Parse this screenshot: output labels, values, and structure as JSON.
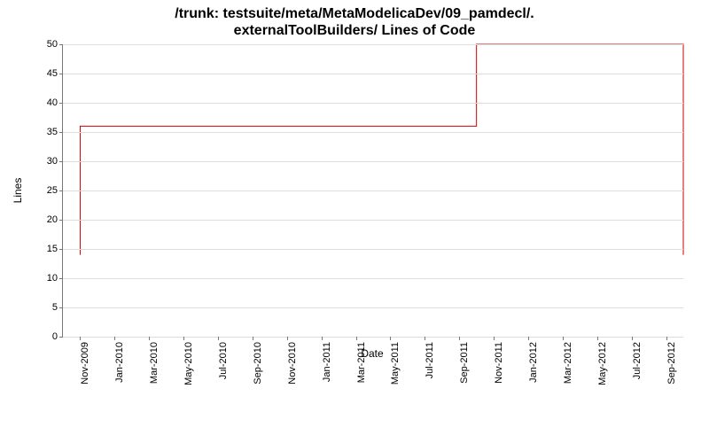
{
  "chart_data": {
    "type": "line",
    "title_line1": "/trunk: testsuite/meta/MetaModelicaDev/09_pamdecl/.",
    "title_line2": "externalToolBuilders/ Lines of Code",
    "xlabel": "Date",
    "ylabel": "Lines",
    "ylim": [
      0,
      50
    ],
    "y_ticks": [
      0,
      5,
      10,
      15,
      20,
      25,
      30,
      35,
      40,
      45,
      50
    ],
    "x_categories": [
      "Nov-2009",
      "Jan-2010",
      "Mar-2010",
      "May-2010",
      "Jul-2010",
      "Sep-2010",
      "Nov-2010",
      "Jan-2011",
      "Mar-2011",
      "May-2011",
      "Jul-2011",
      "Sep-2011",
      "Nov-2011",
      "Jan-2012",
      "Mar-2012",
      "May-2012",
      "Jul-2012",
      "Sep-2012"
    ],
    "series": [
      {
        "name": "Lines",
        "points": [
          {
            "x": "Nov-2009",
            "y": 14
          },
          {
            "x": "Nov-2009",
            "y": 36
          },
          {
            "x": "Oct-2011",
            "y": 36
          },
          {
            "x": "Oct-2011",
            "y": 50
          },
          {
            "x": "Oct-2012",
            "y": 50
          },
          {
            "x": "Oct-2012",
            "y": 14
          }
        ]
      }
    ]
  }
}
